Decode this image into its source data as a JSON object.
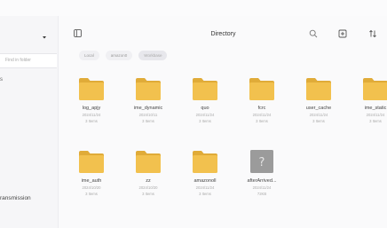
{
  "sidebar": {
    "search_placeholder": "Find in folder",
    "item_a": "s",
    "item_b": "ransmission"
  },
  "main": {
    "title": "Directory",
    "breadcrumbs": [
      "Local",
      "amazon0",
      "Workbase"
    ],
    "items": [
      {
        "name": "log_apjy",
        "date": "2024/11/24",
        "count": "3 Items",
        "type": "folder"
      },
      {
        "name": "ime_dynamic",
        "date": "2024/10/11",
        "count": "3 Items",
        "type": "folder"
      },
      {
        "name": "quo",
        "date": "2024/11/24",
        "count": "3 Items",
        "type": "folder"
      },
      {
        "name": "fcrc",
        "date": "2024/11/24",
        "count": "3 Items",
        "type": "folder"
      },
      {
        "name": "user_cache",
        "date": "2024/11/24",
        "count": "3 Items",
        "type": "folder"
      },
      {
        "name": "ime_static",
        "date": "2024/11/24",
        "count": "3 Items",
        "type": "folder"
      },
      {
        "name": "ime_auth",
        "date": "2024/10/20",
        "count": "3 Items",
        "type": "folder"
      },
      {
        "name": "zz",
        "date": "2024/10/20",
        "count": "3 Items",
        "type": "folder"
      },
      {
        "name": "amazonoll",
        "date": "2024/11/24",
        "count": "3 Items",
        "type": "folder"
      },
      {
        "name": "afterArrived...",
        "date": "2024/11/24",
        "count": "72KB",
        "type": "unknown"
      }
    ]
  },
  "colors": {
    "folder": "#f2c14e",
    "folder_dark": "#e0ab38",
    "unknown_file": "#9b9b9b"
  }
}
